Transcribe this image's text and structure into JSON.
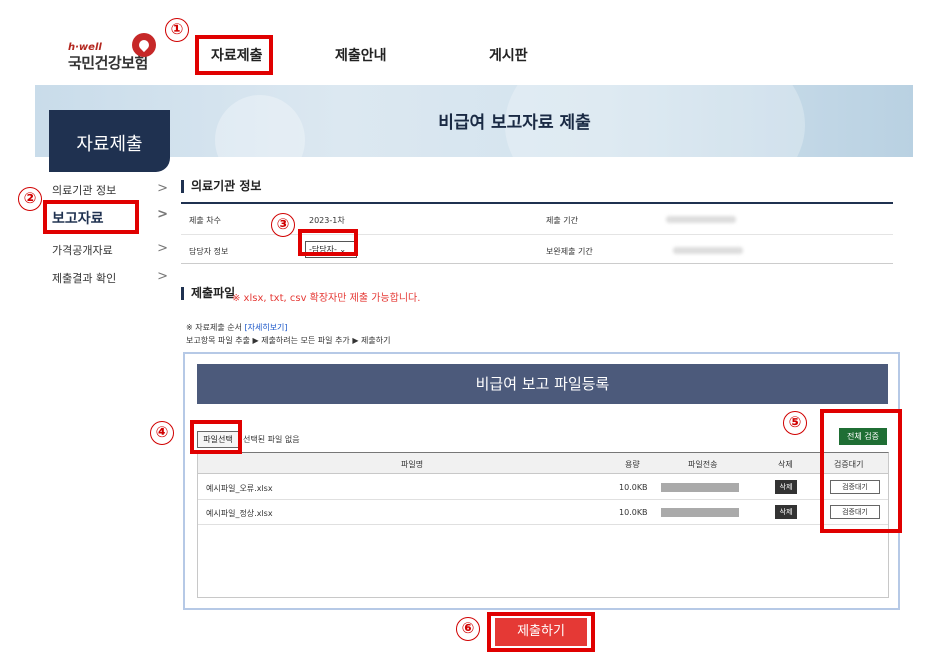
{
  "logo": {
    "tagline": "h·well",
    "name": "국민건강보험"
  },
  "nav": {
    "items": [
      "자료제출",
      "제출안내",
      "게시판"
    ]
  },
  "banner": {
    "title": "비급여 보고자료 제출"
  },
  "sidebar": {
    "title": "자료제출",
    "items": [
      {
        "label": "의료기관 정보"
      },
      {
        "label": "보고자료"
      },
      {
        "label": "가격공개자료"
      },
      {
        "label": "제출결과 확인"
      }
    ],
    "arrow": ">"
  },
  "info": {
    "section_title": "의료기관 정보",
    "row1": {
      "label1": "제출 차수",
      "value1": "2023-1차",
      "label2": "제출 기간"
    },
    "row2": {
      "label1": "담당자 정보",
      "select_value": "-담당자-",
      "label2": "보완제출 기간"
    }
  },
  "submit_file": {
    "title": "제출파일",
    "note": "※ xlsx, txt, csv 확장자만 제출 가능합니다.",
    "order_prefix": "※ 자료제출 순서 ",
    "order_link": "[자세히보기]",
    "order_steps": "보고항목 파일 추출 ▶ 제출하려는 모든 파일 추가 ▶ 제출하기"
  },
  "panel": {
    "title": "비급여 보고 파일등록",
    "file_select_label": "파일선택",
    "no_file_text": "선택된 파일 없음",
    "verify_all_label": "전체 검증",
    "columns": [
      "파일명",
      "용량",
      "파일전송",
      "삭제",
      "검증대기"
    ],
    "rows": [
      {
        "name": "예시파일_오류.xlsx",
        "size": "10.0KB",
        "delete": "삭제",
        "status": "검증대기"
      },
      {
        "name": "예시파일_정상.xlsx",
        "size": "10.0KB",
        "delete": "삭제",
        "status": "검증대기"
      }
    ]
  },
  "submit_button": "제출하기",
  "step_markers": [
    "①",
    "②",
    "③",
    "④",
    "⑤",
    "⑥"
  ],
  "colors": {
    "annotation_red": "#e00000",
    "navy": "#1f3150",
    "submit_red": "#e53935",
    "verify_green": "#1f6e34"
  }
}
